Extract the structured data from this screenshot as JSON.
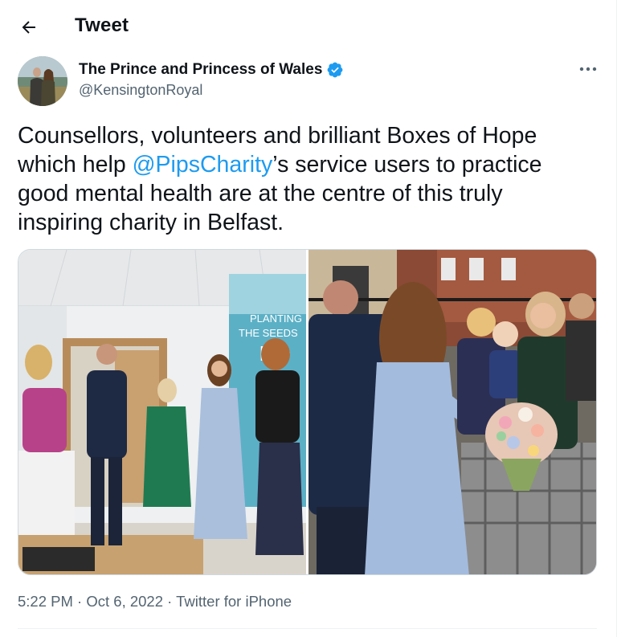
{
  "header": {
    "title": "Tweet",
    "back_icon": "arrow-left-icon"
  },
  "author": {
    "name": "The Prince and Princess of Wales",
    "handle": "@KensingtonRoyal",
    "verified_icon": "verified-badge-icon",
    "verified_color": "#1d9bf0"
  },
  "tweet": {
    "text_before": "Counsellors, volunteers and brilliant Boxes of Hope which help ",
    "mention": "@PipsCharity",
    "text_after": "’s service users to practice good mental health are at the centre of this truly inspiring charity in Belfast."
  },
  "media": {
    "left_photo": {
      "sign_line1": "PLANTING",
      "sign_line2": "THE SEEDS",
      "sign_line3": "HO"
    }
  },
  "meta": {
    "time": "5:22 PM",
    "sep1": " · ",
    "date": "Oct 6, 2022",
    "sep2": " · ",
    "app": "Twitter for iPhone"
  },
  "colors": {
    "accent": "#1d9bf0",
    "text": "#0f1419",
    "secondary": "#536471"
  }
}
